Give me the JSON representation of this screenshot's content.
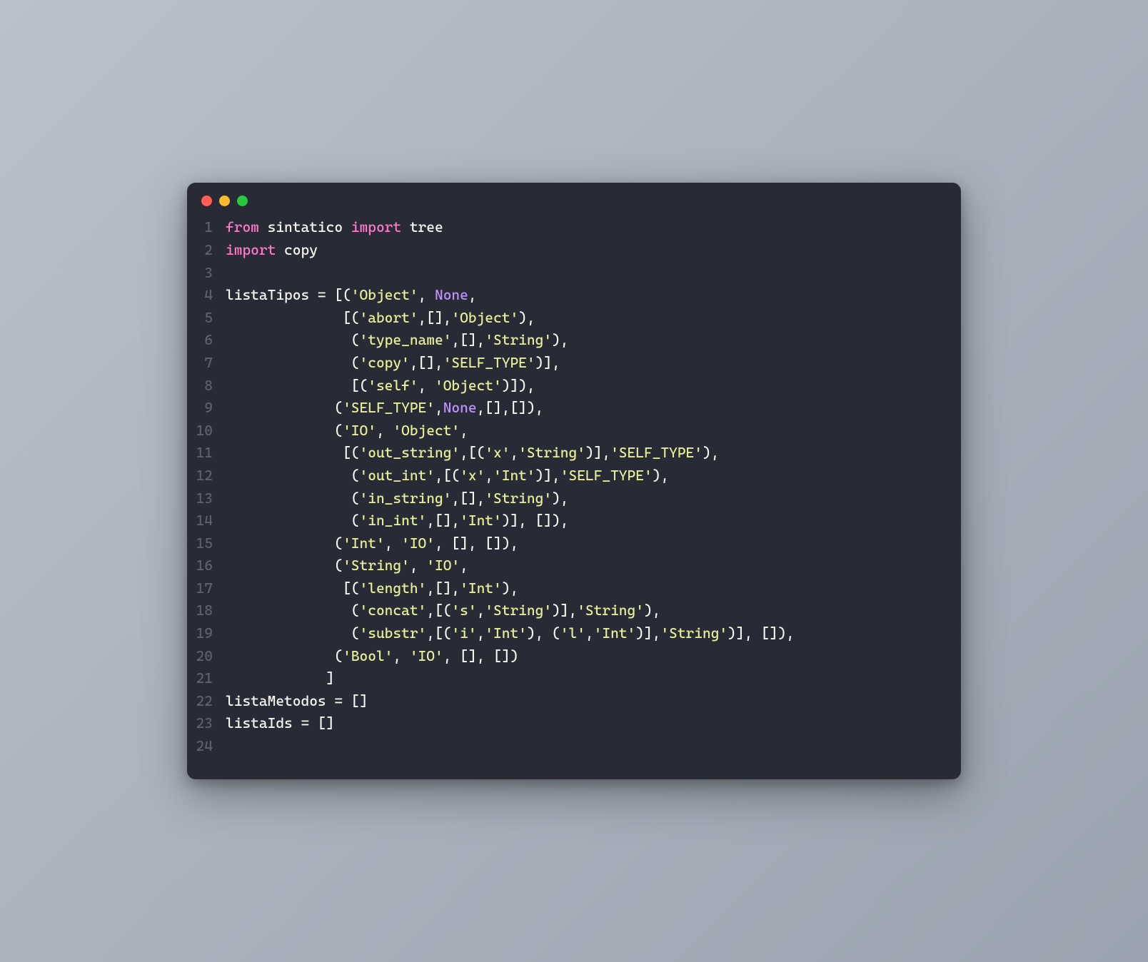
{
  "colors": {
    "background": "#282a36",
    "foreground": "#f8f8f2",
    "keyword": "#ff79c6",
    "string": "#e7ee98",
    "constant": "#bd93f9",
    "lineNumber": "#5b6270",
    "trafficRed": "#ff5f56",
    "trafficYellow": "#ffbd2e",
    "trafficGreen": "#27c93f"
  },
  "language": "python",
  "lines": [
    {
      "n": "1",
      "tokens": [
        [
          "kw",
          "from"
        ],
        [
          "id",
          " sintatico "
        ],
        [
          "kw",
          "import"
        ],
        [
          "id",
          " tree"
        ]
      ]
    },
    {
      "n": "2",
      "tokens": [
        [
          "kw",
          "import"
        ],
        [
          "id",
          " copy"
        ]
      ]
    },
    {
      "n": "3",
      "tokens": []
    },
    {
      "n": "4",
      "tokens": [
        [
          "id",
          "listaTipos "
        ],
        [
          "punc",
          "="
        ],
        [
          "id",
          " "
        ],
        [
          "punc",
          "[("
        ],
        [
          "str",
          "'Object'"
        ],
        [
          "punc",
          ", "
        ],
        [
          "none",
          "None"
        ],
        [
          "punc",
          ","
        ]
      ]
    },
    {
      "n": "5",
      "tokens": [
        [
          "id",
          "              "
        ],
        [
          "punc",
          "[("
        ],
        [
          "str",
          "'abort'"
        ],
        [
          "punc",
          ",[],"
        ],
        [
          "str",
          "'Object'"
        ],
        [
          "punc",
          "),"
        ]
      ]
    },
    {
      "n": "6",
      "tokens": [
        [
          "id",
          "               "
        ],
        [
          "punc",
          "("
        ],
        [
          "str",
          "'type_name'"
        ],
        [
          "punc",
          ",[],"
        ],
        [
          "str",
          "'String'"
        ],
        [
          "punc",
          "),"
        ]
      ]
    },
    {
      "n": "7",
      "tokens": [
        [
          "id",
          "               "
        ],
        [
          "punc",
          "("
        ],
        [
          "str",
          "'copy'"
        ],
        [
          "punc",
          ",[],"
        ],
        [
          "str",
          "'SELF_TYPE'"
        ],
        [
          "punc",
          ")],"
        ]
      ]
    },
    {
      "n": "8",
      "tokens": [
        [
          "id",
          "               "
        ],
        [
          "punc",
          "[("
        ],
        [
          "str",
          "'self'"
        ],
        [
          "punc",
          ", "
        ],
        [
          "str",
          "'Object'"
        ],
        [
          "punc",
          ")]),"
        ]
      ]
    },
    {
      "n": "9",
      "tokens": [
        [
          "id",
          "             "
        ],
        [
          "punc",
          "("
        ],
        [
          "str",
          "'SELF_TYPE'"
        ],
        [
          "punc",
          ","
        ],
        [
          "none",
          "None"
        ],
        [
          "punc",
          ",[],[]),"
        ]
      ]
    },
    {
      "n": "10",
      "tokens": [
        [
          "id",
          "             "
        ],
        [
          "punc",
          "("
        ],
        [
          "str",
          "'IO'"
        ],
        [
          "punc",
          ", "
        ],
        [
          "str",
          "'Object'"
        ],
        [
          "punc",
          ","
        ]
      ]
    },
    {
      "n": "11",
      "tokens": [
        [
          "id",
          "              "
        ],
        [
          "punc",
          "[("
        ],
        [
          "str",
          "'out_string'"
        ],
        [
          "punc",
          ",[("
        ],
        [
          "str",
          "'x'"
        ],
        [
          "punc",
          ","
        ],
        [
          "str",
          "'String'"
        ],
        [
          "punc",
          ")],"
        ],
        [
          "str",
          "'SELF_TYPE'"
        ],
        [
          "punc",
          "),"
        ]
      ]
    },
    {
      "n": "12",
      "tokens": [
        [
          "id",
          "               "
        ],
        [
          "punc",
          "("
        ],
        [
          "str",
          "'out_int'"
        ],
        [
          "punc",
          ",[("
        ],
        [
          "str",
          "'x'"
        ],
        [
          "punc",
          ","
        ],
        [
          "str",
          "'Int'"
        ],
        [
          "punc",
          ")],"
        ],
        [
          "str",
          "'SELF_TYPE'"
        ],
        [
          "punc",
          "),"
        ]
      ]
    },
    {
      "n": "13",
      "tokens": [
        [
          "id",
          "               "
        ],
        [
          "punc",
          "("
        ],
        [
          "str",
          "'in_string'"
        ],
        [
          "punc",
          ",[],"
        ],
        [
          "str",
          "'String'"
        ],
        [
          "punc",
          "),"
        ]
      ]
    },
    {
      "n": "14",
      "tokens": [
        [
          "id",
          "               "
        ],
        [
          "punc",
          "("
        ],
        [
          "str",
          "'in_int'"
        ],
        [
          "punc",
          ",[],"
        ],
        [
          "str",
          "'Int'"
        ],
        [
          "punc",
          ")], []),"
        ]
      ]
    },
    {
      "n": "15",
      "tokens": [
        [
          "id",
          "             "
        ],
        [
          "punc",
          "("
        ],
        [
          "str",
          "'Int'"
        ],
        [
          "punc",
          ", "
        ],
        [
          "str",
          "'IO'"
        ],
        [
          "punc",
          ", [], []),"
        ]
      ]
    },
    {
      "n": "16",
      "tokens": [
        [
          "id",
          "             "
        ],
        [
          "punc",
          "("
        ],
        [
          "str",
          "'String'"
        ],
        [
          "punc",
          ", "
        ],
        [
          "str",
          "'IO'"
        ],
        [
          "punc",
          ","
        ]
      ]
    },
    {
      "n": "17",
      "tokens": [
        [
          "id",
          "              "
        ],
        [
          "punc",
          "[("
        ],
        [
          "str",
          "'length'"
        ],
        [
          "punc",
          ",[],"
        ],
        [
          "str",
          "'Int'"
        ],
        [
          "punc",
          "),"
        ]
      ]
    },
    {
      "n": "18",
      "tokens": [
        [
          "id",
          "               "
        ],
        [
          "punc",
          "("
        ],
        [
          "str",
          "'concat'"
        ],
        [
          "punc",
          ",[("
        ],
        [
          "str",
          "'s'"
        ],
        [
          "punc",
          ","
        ],
        [
          "str",
          "'String'"
        ],
        [
          "punc",
          ")],"
        ],
        [
          "str",
          "'String'"
        ],
        [
          "punc",
          "),"
        ]
      ]
    },
    {
      "n": "19",
      "tokens": [
        [
          "id",
          "               "
        ],
        [
          "punc",
          "("
        ],
        [
          "str",
          "'substr'"
        ],
        [
          "punc",
          ",[("
        ],
        [
          "str",
          "'i'"
        ],
        [
          "punc",
          ","
        ],
        [
          "str",
          "'Int'"
        ],
        [
          "punc",
          "), ("
        ],
        [
          "str",
          "'l'"
        ],
        [
          "punc",
          ","
        ],
        [
          "str",
          "'Int'"
        ],
        [
          "punc",
          ")],"
        ],
        [
          "str",
          "'String'"
        ],
        [
          "punc",
          ")], []),"
        ]
      ]
    },
    {
      "n": "20",
      "tokens": [
        [
          "id",
          "             "
        ],
        [
          "punc",
          "("
        ],
        [
          "str",
          "'Bool'"
        ],
        [
          "punc",
          ", "
        ],
        [
          "str",
          "'IO'"
        ],
        [
          "punc",
          ", [], [])"
        ]
      ]
    },
    {
      "n": "21",
      "tokens": [
        [
          "id",
          "            "
        ],
        [
          "punc",
          "]"
        ]
      ]
    },
    {
      "n": "22",
      "tokens": [
        [
          "id",
          "listaMetodos "
        ],
        [
          "punc",
          "="
        ],
        [
          "id",
          " "
        ],
        [
          "punc",
          "[]"
        ]
      ]
    },
    {
      "n": "23",
      "tokens": [
        [
          "id",
          "listaIds "
        ],
        [
          "punc",
          "="
        ],
        [
          "id",
          " "
        ],
        [
          "punc",
          "[]"
        ]
      ]
    },
    {
      "n": "24",
      "tokens": []
    }
  ]
}
